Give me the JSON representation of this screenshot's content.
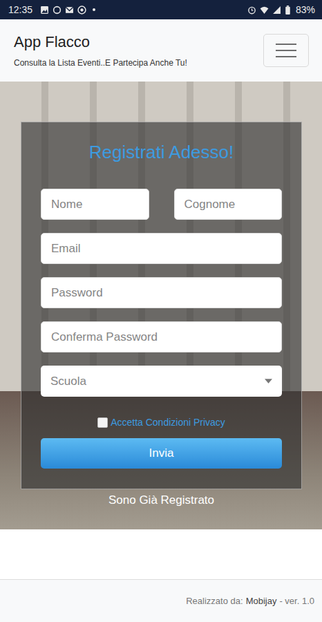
{
  "status_bar": {
    "time": "12:35",
    "battery": "83%"
  },
  "navbar": {
    "title": "App Flacco",
    "subtitle": "Consulta la Lista Eventi..E Partecipa Anche Tu!",
    "menu_expanded": false
  },
  "form": {
    "title": "Registrati Adesso!",
    "name_fields": [
      {
        "placeholder": "Nome"
      },
      {
        "placeholder": "Cognome"
      }
    ],
    "fields": [
      {
        "placeholder": "Email",
        "type": "email"
      },
      {
        "placeholder": "Password",
        "type": "password"
      },
      {
        "placeholder": "Conferma Password",
        "type": "password"
      }
    ],
    "select": {
      "placeholder": "Scuola"
    },
    "privacy": {
      "label": "Accetta Condizioni Privacy",
      "checked": false
    },
    "submit": "Invia"
  },
  "login_link": "Sono Già Registrato",
  "footer": {
    "prefix": "Realizzato da:",
    "author": "Mobijay",
    "version": "- ver. 1.0"
  }
}
